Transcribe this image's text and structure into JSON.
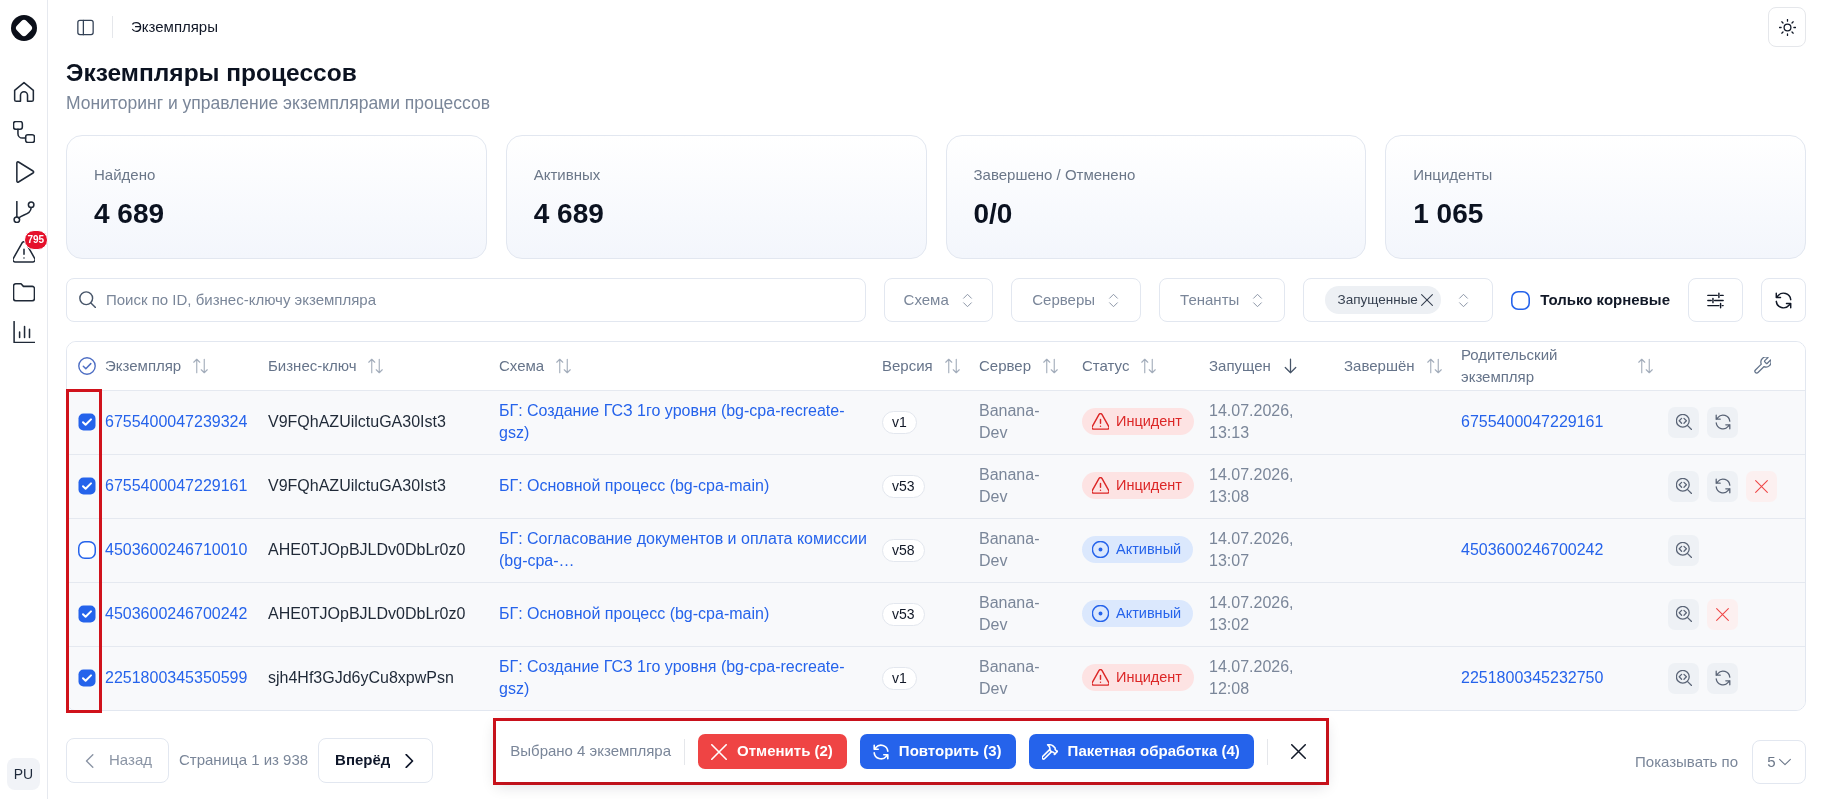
{
  "sidebar": {
    "alerts_badge": "795",
    "avatar": "PU"
  },
  "header": {
    "breadcrumb": "Экземпляры"
  },
  "page": {
    "title": "Экземпляры процессов",
    "subtitle": "Мониторинг и управление экземплярами процессов"
  },
  "stats": [
    {
      "label": "Найдено",
      "value": "4 689"
    },
    {
      "label": "Активных",
      "value": "4 689"
    },
    {
      "label": "Завершено / Отменено",
      "value": "0/0"
    },
    {
      "label": "Инциденты",
      "value": "1 065"
    }
  ],
  "filters": {
    "search": {
      "placeholder": "Поиск по ID, бизнес-ключу экземпляра"
    },
    "dropdowns": [
      {
        "label": "Схема"
      },
      {
        "label": "Серверы"
      },
      {
        "label": "Тенанты"
      }
    ],
    "status": {
      "chips": [
        "Запущенные"
      ]
    },
    "root_only": {
      "label": "Только корневые",
      "checked": false
    }
  },
  "table": {
    "select_all": {
      "partial": true
    },
    "columns": [
      {
        "label": "Экземпляр",
        "sorted": false
      },
      {
        "label": "Бизнес-ключ",
        "sorted": false
      },
      {
        "label": "Схема",
        "sorted": false
      },
      {
        "label": "Версия",
        "sorted": false
      },
      {
        "label": "Сервер",
        "sorted": false
      },
      {
        "label": "Статус",
        "sorted": false
      },
      {
        "label": "Запущен",
        "sorted": true
      },
      {
        "label": "Завершён",
        "sorted": false
      },
      {
        "label": "Родительский экземпляр",
        "sorted": false
      }
    ],
    "rows": [
      {
        "selected": true,
        "id": "6755400047239324",
        "business_key": "V9FQhAZUilctuGA30Ist3",
        "schema": "БГ: Создание ГСЗ 1го уровня (bg-cpa-recreate-gsz)",
        "version": "v1",
        "server": "Banana-Dev",
        "status": {
          "kind": "incident",
          "label": "Инцидент"
        },
        "started": "14.07.2026, 13:13",
        "parent": "6755400047229161",
        "actions": [
          {
            "kind": "inspect"
          },
          {
            "kind": "retry"
          }
        ]
      },
      {
        "selected": true,
        "id": "6755400047229161",
        "business_key": "V9FQhAZUilctuGA30Ist3",
        "schema": "БГ: Основной процесс (bg-cpa-main)",
        "version": "v53",
        "server": "Banana-Dev",
        "status": {
          "kind": "incident",
          "label": "Инцидент"
        },
        "started": "14.07.2026, 13:08",
        "actions": [
          {
            "kind": "inspect"
          },
          {
            "kind": "retry"
          },
          {
            "kind": "cancel"
          }
        ]
      },
      {
        "selected": false,
        "id": "4503600246710010",
        "business_key": "AHE0TJOpBJLDv0DbLr0z0",
        "schema": "БГ: Согласование документов и оплата комиссии (bg-cpa-…",
        "version": "v58",
        "server": "Banana-Dev",
        "status": {
          "kind": "active",
          "label": "Активный"
        },
        "started": "14.07.2026, 13:07",
        "parent": "4503600246700242",
        "actions": [
          {
            "kind": "inspect"
          }
        ]
      },
      {
        "selected": true,
        "id": "4503600246700242",
        "business_key": "AHE0TJOpBJLDv0DbLr0z0",
        "schema": "БГ: Основной процесс (bg-cpa-main)",
        "version": "v53",
        "server": "Banana-Dev",
        "status": {
          "kind": "active",
          "label": "Активный"
        },
        "started": "14.07.2026, 13:02",
        "actions": [
          {
            "kind": "inspect"
          },
          {
            "kind": "cancel"
          }
        ]
      },
      {
        "selected": true,
        "id": "2251800345350599",
        "business_key": "sjh4Hf3GJd6yCu8xpwPsn",
        "schema": "БГ: Создание ГСЗ 1го уровня (bg-cpa-recreate-gsz)",
        "version": "v1",
        "server": "Banana-Dev",
        "status": {
          "kind": "incident",
          "label": "Инцидент"
        },
        "started": "14.07.2026, 12:08",
        "parent": "2251800345232750",
        "actions": [
          {
            "kind": "inspect"
          },
          {
            "kind": "retry"
          }
        ]
      }
    ]
  },
  "pagination": {
    "prev": {
      "label": "Назад",
      "disabled": true
    },
    "page_info": "Страница 1 из 938",
    "next": {
      "label": "Вперёд"
    }
  },
  "bulk_bar": {
    "summary": "Выбрано 4 экземпляра",
    "actions": [
      {
        "kind": "cancel",
        "label": "Отменить (2)"
      },
      {
        "kind": "retry",
        "label": "Повторить (3)"
      },
      {
        "kind": "batch",
        "label": "Пакетная обработка (4)"
      }
    ]
  },
  "page_size": {
    "label": "Показывать по",
    "value": "5"
  }
}
